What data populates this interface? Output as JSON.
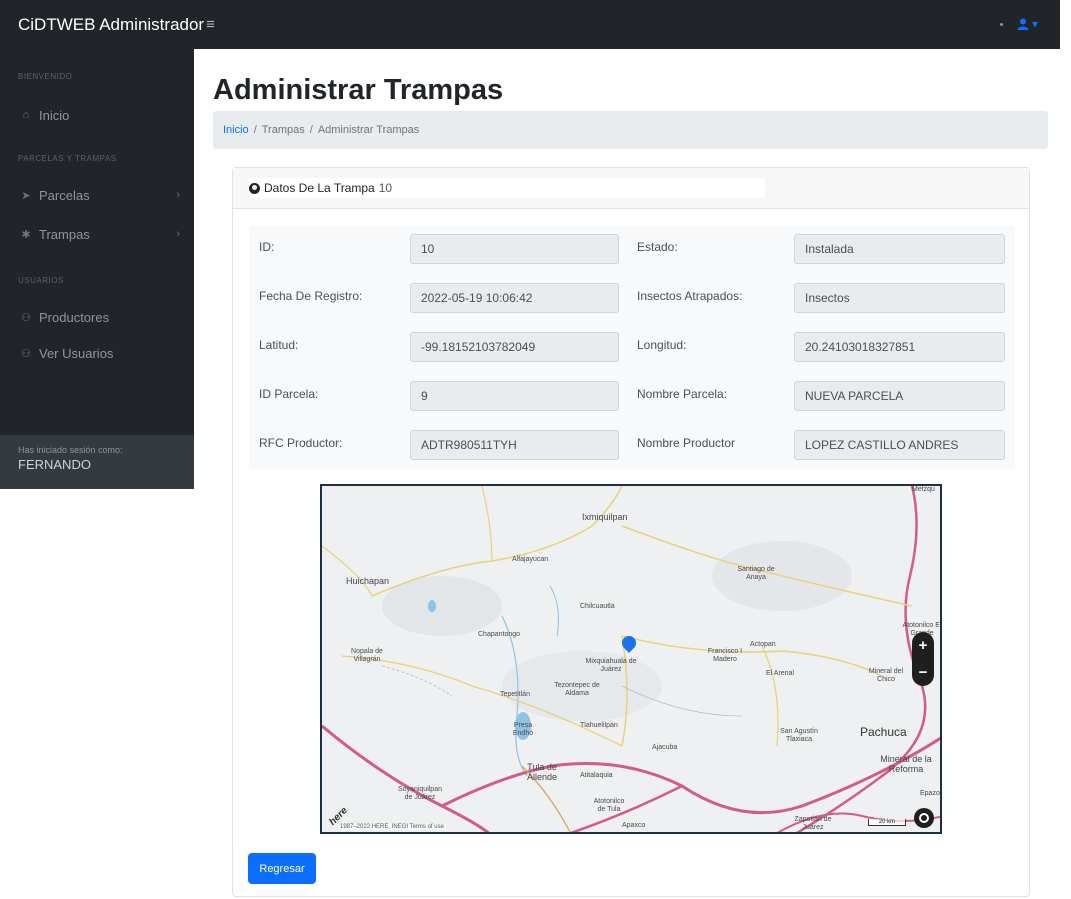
{
  "topbar": {
    "brand": "CiDTWEB Administrador",
    "menu_icon": "hamburger-icon",
    "user_icon": "user-icon"
  },
  "sidebar": {
    "sections": [
      {
        "heading": "BIENVENIDO",
        "items": [
          {
            "label": "Inicio",
            "icon": "home-icon"
          }
        ]
      },
      {
        "heading": "PARCELAS Y TRAMPAS",
        "items": [
          {
            "label": "Parcelas",
            "icon": "location-arrow-icon"
          },
          {
            "label": "Trampas",
            "icon": "bug-icon"
          }
        ]
      },
      {
        "heading": "USUARIOS",
        "items": [
          {
            "label": "Productores",
            "icon": "users-icon"
          },
          {
            "label": "Ver Usuarios",
            "icon": "users-icon"
          }
        ]
      }
    ],
    "footer": {
      "caption": "Has iniciado sesión como:",
      "user": "FERNANDO"
    }
  },
  "page": {
    "title": "Administrar Trampas",
    "breadcrumb": {
      "home": "Inicio",
      "level2": "Trampas",
      "level3": "Administrar Trampas"
    }
  },
  "card": {
    "header_label": "Datos De La Trampa",
    "trap_id": "10",
    "fields": {
      "id": {
        "label": "ID:",
        "value": "10"
      },
      "estado": {
        "label": "Estado:",
        "value": "Instalada"
      },
      "fecha": {
        "label": "Fecha De Registro:",
        "value": "2022-05-19 10:06:42"
      },
      "insectos": {
        "label": "Insectos Atrapados:",
        "value": "Insectos"
      },
      "latitud": {
        "label": "Latitud:",
        "value": "-99.18152103782049"
      },
      "longitud": {
        "label": "Longitud:",
        "value": "20.24103018327851"
      },
      "id_parcela": {
        "label": "ID Parcela:",
        "value": "9"
      },
      "nombre_parcela": {
        "label": "Nombre Parcela:",
        "value": "NUEVA PARCELA"
      },
      "rfc": {
        "label": "RFC Productor:",
        "value": "ADTR980511TYH"
      },
      "nombre_productor": {
        "label": "Nombre Productor",
        "value": "LOPEZ CASTILLO ANDRES"
      }
    },
    "back_button": "Regresar"
  },
  "map": {
    "places": {
      "ixmiquilpan": "Ixmiquilpan",
      "alfajayucan": "Alfajayucan",
      "huichapan": "Huichapan",
      "santiago": "Santiago de Anaya",
      "chilcuautla": "Chilcuautla",
      "chapantongo": "Chapantongo",
      "nopala": "Nopala de Villagrán",
      "mixquiahuala": "Mixquiahuala de Juárez",
      "francisco": "Francisco I Madero",
      "actopan": "Actopan",
      "el_arenal": "El Arenal",
      "mineral_chico": "Mineral del Chico",
      "tepetitlan": "Tepetitlán",
      "tezontepec": "Tezontepec de Aldama",
      "tlahuelilpan": "Tlahuelilpan",
      "san_agustin": "San Agustín Tlaxiaca",
      "pachuca": "Pachuca",
      "tula": "Tula de Allende",
      "ajacuba": "Ajacuba",
      "atitalaquia": "Atitalaquia",
      "mineral_reforma": "Mineral de la Reforma",
      "soyaniquilpan": "Soyaniquilpan de Juárez",
      "atotonilco": "Atotonilco de Tula",
      "apaxco": "Apaxco",
      "zapotlan": "Zapotlán de Juárez",
      "atotonilco_grande": "Atotonilco El Grande",
      "epazoyucan": "Epazo",
      "presa": "Presa Endhó",
      "metztitlan": "Metzqu"
    },
    "copyright": "1987–2022 HERE, INEGI Terms of use",
    "logo": "here",
    "scale": "20 km",
    "zoom_in": "+",
    "zoom_out": "−"
  }
}
